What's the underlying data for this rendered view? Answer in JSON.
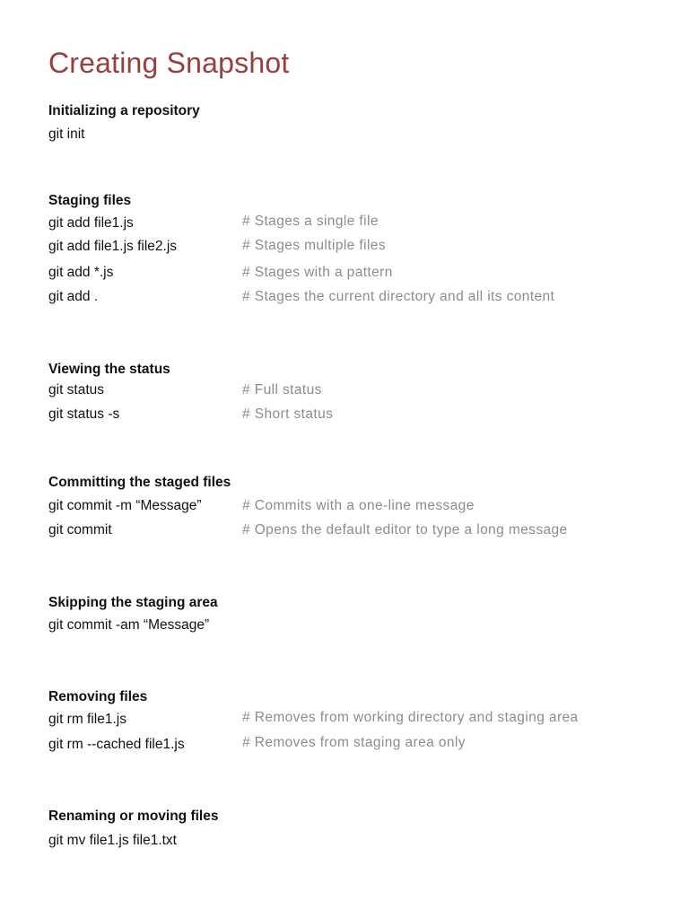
{
  "title": "Creating Snapshot",
  "sections": [
    {
      "heading": "Initializing a repository",
      "rows": [
        {
          "cmd": "git init",
          "comment": ""
        }
      ]
    },
    {
      "heading": "Staging files",
      "rows": [
        {
          "cmd": "git add file1.js",
          "comment": "#  Stages  a  single file"
        },
        {
          "cmd": "git add  file1.js file2.js",
          "comment": "# Stages multiple files"
        },
        {
          "cmd": "git add  *.js",
          "comment": "# Stages with a pattern"
        },
        {
          "cmd": "git add  .",
          "comment": "# Stages the current directory and all its content"
        }
      ]
    },
    {
      "heading": "Viewing  the status",
      "rows": [
        {
          "cmd": "git  status",
          "comment": "# Full status"
        },
        {
          "cmd": "git status  -s",
          "comment": "# Short status"
        }
      ]
    },
    {
      "heading": "Committing the staged files",
      "rows": [
        {
          "cmd": "git commit -m “Message”",
          "comment": "# Commits with a one-line message"
        },
        {
          "cmd": "git commit",
          "comment": "# Opens the default editor to type a long message"
        }
      ]
    },
    {
      "heading": "Skipping the staging area",
      "rows": [
        {
          "cmd": "git commit -am “Message”",
          "comment": ""
        }
      ]
    },
    {
      "heading": "Removing  files",
      "rows": [
        {
          "cmd": "git rm file1.js",
          "comment": "# Removes from working directory and staging area"
        },
        {
          "cmd": "git rm --cached file1.js",
          "comment": "# Removes from staging area only"
        }
      ]
    },
    {
      "heading": "Renaming or moving files",
      "rows": [
        {
          "cmd": "git mv file1.js file1.txt",
          "comment": ""
        }
      ]
    }
  ]
}
